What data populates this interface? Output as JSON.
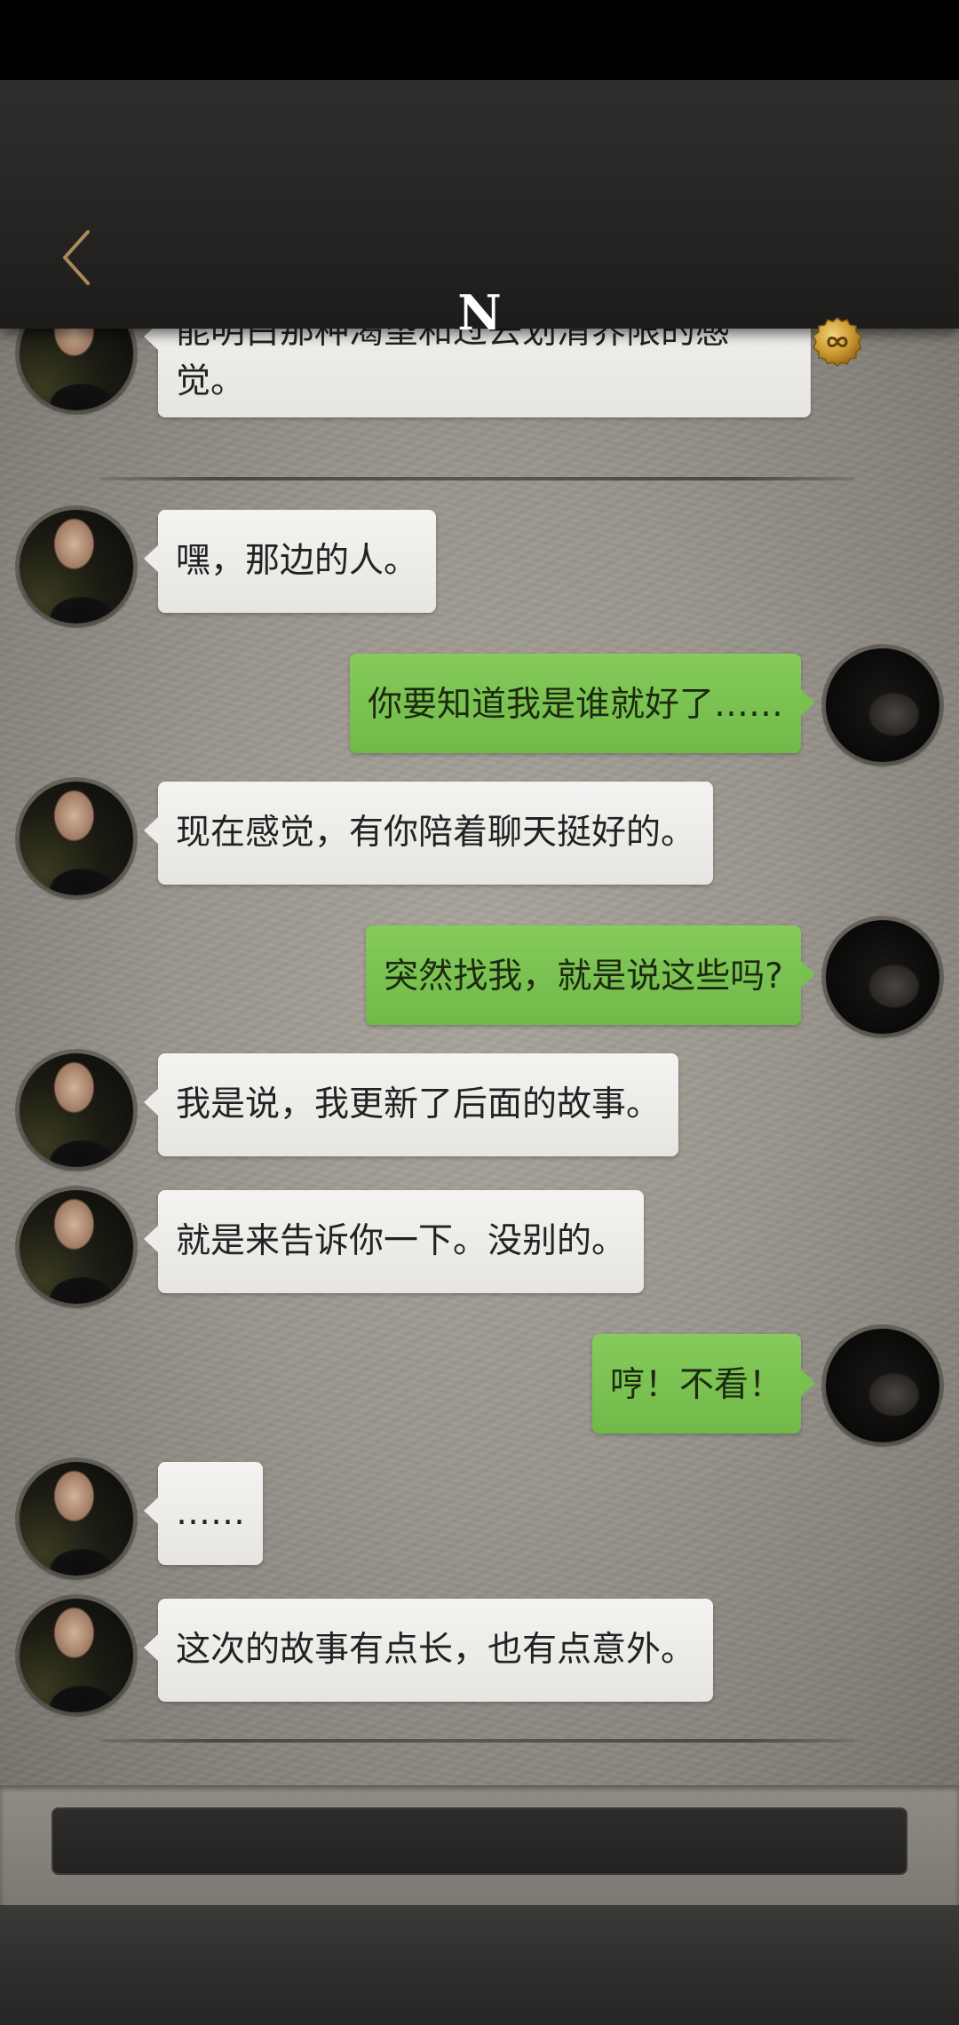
{
  "header": {
    "back_icon": "chevron-left-icon",
    "title": "N",
    "coin_icon": "infinity-coin-icon",
    "accent": "#a88a5a"
  },
  "colors": {
    "self_bubble": "#78c04f",
    "other_bubble": "#efeeeb",
    "chat_background": "#9a968e"
  },
  "messages": [
    {
      "from": "other",
      "text": "能明白那种渴望和过去划清界限的感"
    },
    {
      "from": "other",
      "text": "觉。"
    },
    {
      "from": "other",
      "text": "嘿，那边的人。"
    },
    {
      "from": "self",
      "text": "你要知道我是谁就好了……"
    },
    {
      "from": "other",
      "text": "现在感觉，有你陪着聊天挺好的。"
    },
    {
      "from": "self",
      "text": "突然找我，就是说这些吗?"
    },
    {
      "from": "other",
      "text": "我是说，我更新了后面的故事。"
    },
    {
      "from": "other",
      "text": "就是来告诉你一下。没别的。"
    },
    {
      "from": "self",
      "text": "哼！不看！"
    },
    {
      "from": "other",
      "text": "……"
    },
    {
      "from": "other",
      "text": "这次的故事有点长，也有点意外。"
    }
  ],
  "input": {
    "value": "",
    "placeholder": ""
  }
}
